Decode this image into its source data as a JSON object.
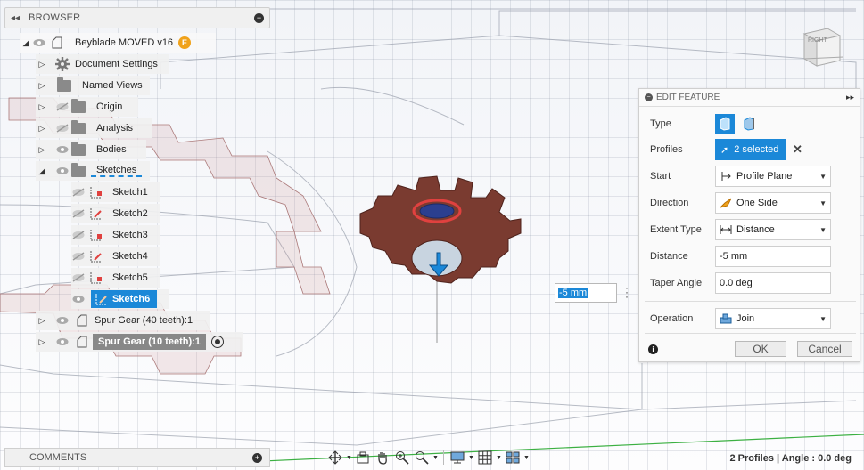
{
  "browser": {
    "title": "BROWSER",
    "root": {
      "label": "Beyblade MOVED v16",
      "badge": "E"
    },
    "items": [
      {
        "label": "Document Settings"
      },
      {
        "label": "Named Views"
      },
      {
        "label": "Origin"
      },
      {
        "label": "Analysis"
      },
      {
        "label": "Bodies"
      },
      {
        "label": "Sketches"
      }
    ],
    "sketches": [
      "Sketch1",
      "Sketch2",
      "Sketch3",
      "Sketch4",
      "Sketch5",
      "Sketch6"
    ],
    "components": [
      {
        "label": "Spur Gear (40 teeth):1"
      },
      {
        "label": "Spur Gear (10 teeth):1"
      }
    ]
  },
  "edit_feature": {
    "title": "EDIT FEATURE",
    "type_label": "Type",
    "profiles_label": "Profiles",
    "profiles_value": "2 selected",
    "start_label": "Start",
    "start_value": "Profile Plane",
    "direction_label": "Direction",
    "direction_value": "One Side",
    "extent_label": "Extent Type",
    "extent_value": "Distance",
    "distance_label": "Distance",
    "distance_value": "-5 mm",
    "taper_label": "Taper Angle",
    "taper_value": "0.0 deg",
    "operation_label": "Operation",
    "operation_value": "Join",
    "ok_label": "OK",
    "cancel_label": "Cancel"
  },
  "viewport": {
    "distance_input": "-5 mm",
    "viewcube_label": "RIGHT"
  },
  "comments": {
    "title": "COMMENTS"
  },
  "status_text": "2 Profiles | Angle : 0.0 deg",
  "colors": {
    "accent": "#1b88d8",
    "gear_body": "#7a3b30",
    "selection_ring": "#e0413f",
    "badge": "#f0a21b"
  }
}
